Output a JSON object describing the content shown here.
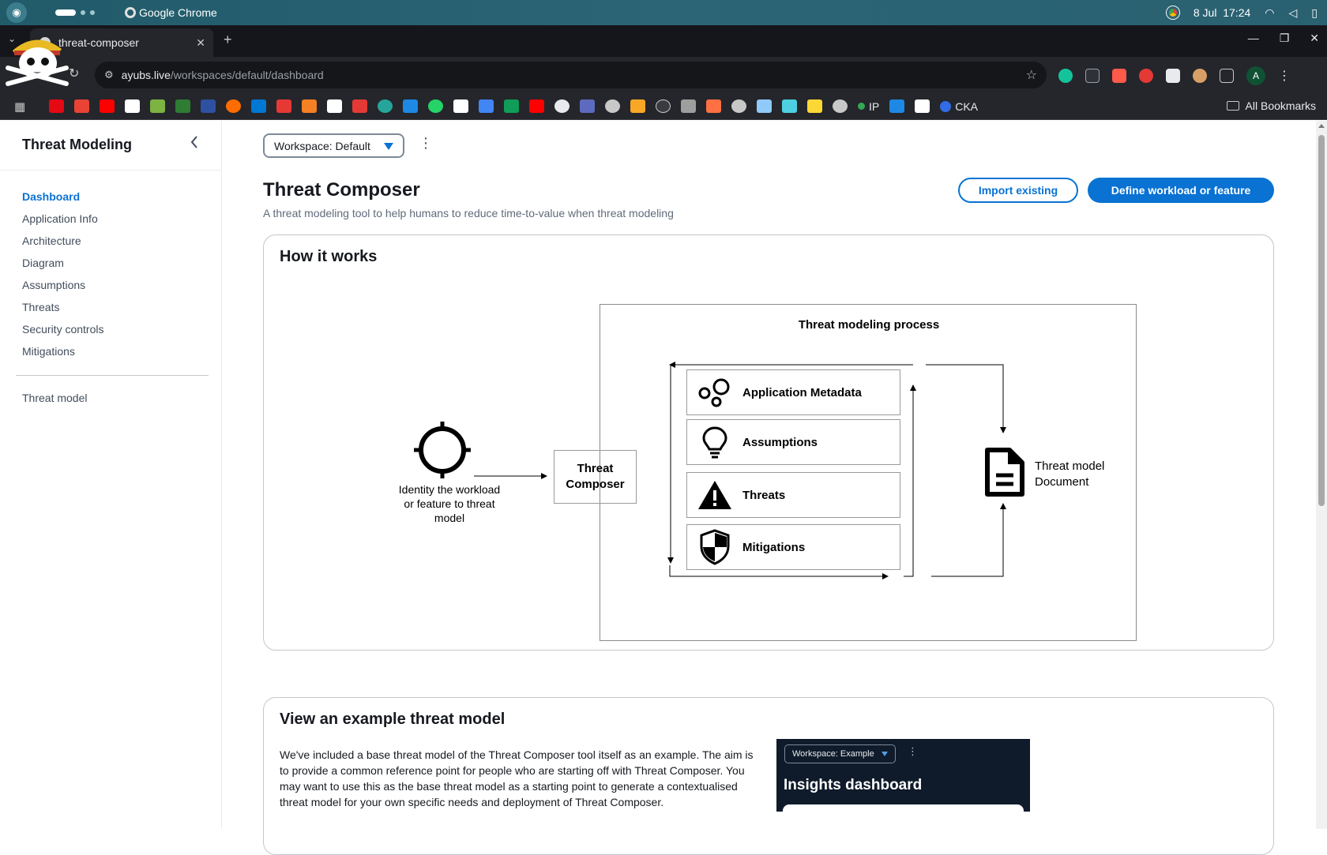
{
  "os": {
    "app_name": "Google Chrome",
    "date": "8 Jul",
    "time": "17:24"
  },
  "browser": {
    "tab_title": "threat-composer",
    "url_host": "ayubs.live",
    "url_path": "/workspaces/default/dashboard",
    "profile_initial": "A",
    "bookmarks_text": [
      "IP",
      "CKA"
    ],
    "all_bookmarks": "All Bookmarks"
  },
  "sidebar": {
    "title": "Threat Modeling",
    "items": [
      {
        "label": "Dashboard",
        "active": true
      },
      {
        "label": "Application Info"
      },
      {
        "label": "Architecture"
      },
      {
        "label": "Diagram"
      },
      {
        "label": "Assumptions"
      },
      {
        "label": "Threats"
      },
      {
        "label": "Security controls"
      },
      {
        "label": "Mitigations"
      }
    ],
    "secondary_item": "Threat model"
  },
  "header": {
    "workspace_select": "Workspace: Default",
    "title": "Threat Composer",
    "subtitle": "A threat modeling tool to help humans to reduce time-to-value when threat modeling",
    "import_button": "Import existing",
    "define_button": "Define workload or feature"
  },
  "how_it_works": {
    "title": "How it works",
    "process_title": "Threat modeling process",
    "identity_label": "Identity the workload or feature to threat model",
    "composer_label_1": "Threat",
    "composer_label_2": "Composer",
    "steps": [
      "Application Metadata",
      "Assumptions",
      "Threats",
      "Mitigations"
    ],
    "document_label_1": "Threat model",
    "document_label_2": "Document"
  },
  "example": {
    "title": "View an example threat model",
    "text": "We've included a base threat model of the Threat Composer tool itself as an example. The aim is to provide a common reference point for people who are starting off with Threat Composer. You may want to use this as the base threat model as a starting point to generate a contextualised threat model for your own specific needs and deployment of Threat Composer.",
    "preview_workspace": "Workspace: Example",
    "preview_heading": "Insights dashboard"
  },
  "colors": {
    "accent": "#0972d3",
    "text": "#16191f",
    "muted": "#5f6b7a"
  }
}
